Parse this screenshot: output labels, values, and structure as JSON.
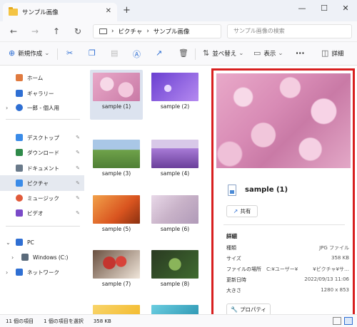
{
  "window": {
    "tab_title": "サンプル画像",
    "new_tab": "+",
    "close_tab": "✕",
    "minimize": "—",
    "maximize": "☐",
    "close": "✕"
  },
  "nav": {
    "back": "←",
    "forward": "→",
    "up": "↑",
    "refresh": "↻",
    "breadcrumb": [
      "ピクチャ",
      "サンプル画像"
    ],
    "separator": "›",
    "search_placeholder": "サンプル画像の検索"
  },
  "toolbar": {
    "new_label": "新規作成",
    "sort_label": "並べ替え",
    "view_label": "表示",
    "more": "···",
    "details_label": "詳細",
    "chevron": "⌄"
  },
  "sidebar": {
    "items": [
      {
        "label": "ホーム",
        "icon": "home-icon",
        "color": "#e07a3f"
      },
      {
        "label": "ギャラリー",
        "icon": "gallery-icon",
        "color": "#2f6fd3"
      },
      {
        "label": "一郎 - 個人用",
        "icon": "cloud-icon",
        "color": "#2f6fd3"
      },
      {
        "label": "デスクトップ",
        "icon": "desktop-icon",
        "color": "#3a8be8"
      },
      {
        "label": "ダウンロード",
        "icon": "download-icon",
        "color": "#2f8a4a"
      },
      {
        "label": "ドキュメント",
        "icon": "document-icon",
        "color": "#6a7a8a"
      },
      {
        "label": "ピクチャ",
        "icon": "pictures-icon",
        "color": "#3a8be8"
      },
      {
        "label": "ミュージック",
        "icon": "music-icon",
        "color": "#e05a3a"
      },
      {
        "label": "ビデオ",
        "icon": "video-icon",
        "color": "#7a4ac8"
      },
      {
        "label": "PC",
        "icon": "pc-icon",
        "color": "#2f6fd3"
      },
      {
        "label": "Windows (C:)",
        "icon": "drive-icon",
        "color": "#5a6a7a"
      },
      {
        "label": "ネットワーク",
        "icon": "network-icon",
        "color": "#2f6fd3"
      }
    ]
  },
  "files": [
    {
      "name": "sample (1)",
      "colors": [
        "#e9a9c9",
        "#c97aa6"
      ]
    },
    {
      "name": "sample (2)",
      "colors": [
        "#6a3fd1",
        "#b58af0"
      ]
    },
    {
      "name": "sample (3)",
      "colors": [
        "#6fa24a",
        "#a9c7e6"
      ]
    },
    {
      "name": "sample (4)",
      "colors": [
        "#a77ad6",
        "#6a3f9a"
      ]
    },
    {
      "name": "sample (5)",
      "colors": [
        "#d9541f",
        "#f2a14a"
      ]
    },
    {
      "name": "sample (6)",
      "colors": [
        "#c8b2c8",
        "#e8d8e8"
      ]
    },
    {
      "name": "sample (7)",
      "colors": [
        "#c4352f",
        "#f0e6da"
      ]
    },
    {
      "name": "sample (8)",
      "colors": [
        "#3f6a2f",
        "#8ab45a"
      ]
    },
    {
      "name": "",
      "colors": [
        "#f2b41f",
        "#f8d46a"
      ]
    },
    {
      "name": "",
      "colors": [
        "#1f8aa8",
        "#6acde0"
      ]
    }
  ],
  "preview": {
    "file_name": "sample (1)",
    "share_label": "共有",
    "details_title": "詳細",
    "rows": [
      {
        "key": "種類",
        "value": "JPG ファイル"
      },
      {
        "key": "サイズ",
        "value": "358 KB"
      },
      {
        "key": "ファイルの場所",
        "value": "C:¥ユーザー¥　　　¥ピクチャ¥サ…"
      },
      {
        "key": "更新日時",
        "value": "2022/09/13 11:06"
      },
      {
        "key": "大きさ",
        "value": "1280 x 853"
      }
    ],
    "properties_label": "プロパティ"
  },
  "status": {
    "count": "11 個の項目",
    "selected": "1 個の項目を選択",
    "size": "358 KB"
  }
}
